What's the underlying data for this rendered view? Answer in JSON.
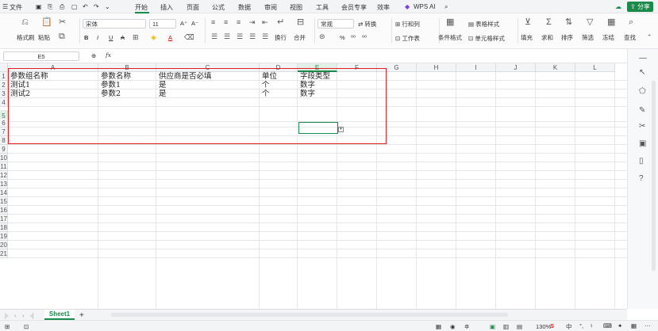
{
  "menubar": {
    "file": "文件",
    "tabs": [
      "开始",
      "插入",
      "页面",
      "公式",
      "数据",
      "审阅",
      "视图",
      "工具",
      "会员专享",
      "效率"
    ],
    "active_tab": "开始",
    "wps_ai": "WPS AI",
    "share": "分享"
  },
  "ribbon": {
    "format_painter": "格式刷",
    "paste": "粘贴",
    "font_name": "宋体",
    "font_size": "11",
    "bold": "B",
    "italic": "I",
    "underline": "U",
    "strike": "A",
    "wrap": "换行",
    "merge": "合并",
    "number_format": "常规",
    "convert": "转换",
    "rows_cols": "行和列",
    "worksheet": "工作表",
    "cond_format": "条件格式",
    "table_style": "表格样式",
    "cell_style": "单元格样式",
    "fill": "填充",
    "sum": "求和",
    "sort": "排序",
    "filter": "筛选",
    "freeze": "冻结",
    "find": "查找",
    "increase_font": "A⁺",
    "decrease_font": "A⁻",
    "percent": "%",
    "decimals": "⁰⁰",
    "comma": "⁰⁰"
  },
  "formula_bar": {
    "cell_ref": "E5",
    "fx": "fx",
    "value": ""
  },
  "columns": [
    "A",
    "B",
    "C",
    "D",
    "E",
    "F",
    "G",
    "H",
    "I",
    "J",
    "K",
    "L"
  ],
  "selected_column": "E",
  "rows": [
    "1",
    "2",
    "3",
    "4",
    "5",
    "6",
    "7",
    "8",
    "9",
    "10",
    "11",
    "12",
    "13",
    "14",
    "15",
    "16",
    "17",
    "18",
    "19",
    "20",
    "21"
  ],
  "selected_row": "5",
  "cells": [
    {
      "ref": "A1",
      "text": "参数组名称"
    },
    {
      "ref": "B1",
      "text": "参数名称"
    },
    {
      "ref": "C1",
      "text": "供应商是否必填"
    },
    {
      "ref": "D1",
      "text": "单位"
    },
    {
      "ref": "E1",
      "text": "字段类型"
    },
    {
      "ref": "A2",
      "text": "测试1"
    },
    {
      "ref": "B2",
      "text": "参数1"
    },
    {
      "ref": "C2",
      "text": "是"
    },
    {
      "ref": "D2",
      "text": "个"
    },
    {
      "ref": "E2",
      "text": "数字"
    },
    {
      "ref": "A3",
      "text": "测试2"
    },
    {
      "ref": "B3",
      "text": "参数2"
    },
    {
      "ref": "C3",
      "text": "是"
    },
    {
      "ref": "D3",
      "text": "个"
    },
    {
      "ref": "E3",
      "text": "数字"
    }
  ],
  "sheet_tab": "Sheet1",
  "status": {
    "zoom": "130%",
    "ime": "中"
  },
  "colors": {
    "accent": "#1a8a4a",
    "annotation": "#e02020"
  }
}
